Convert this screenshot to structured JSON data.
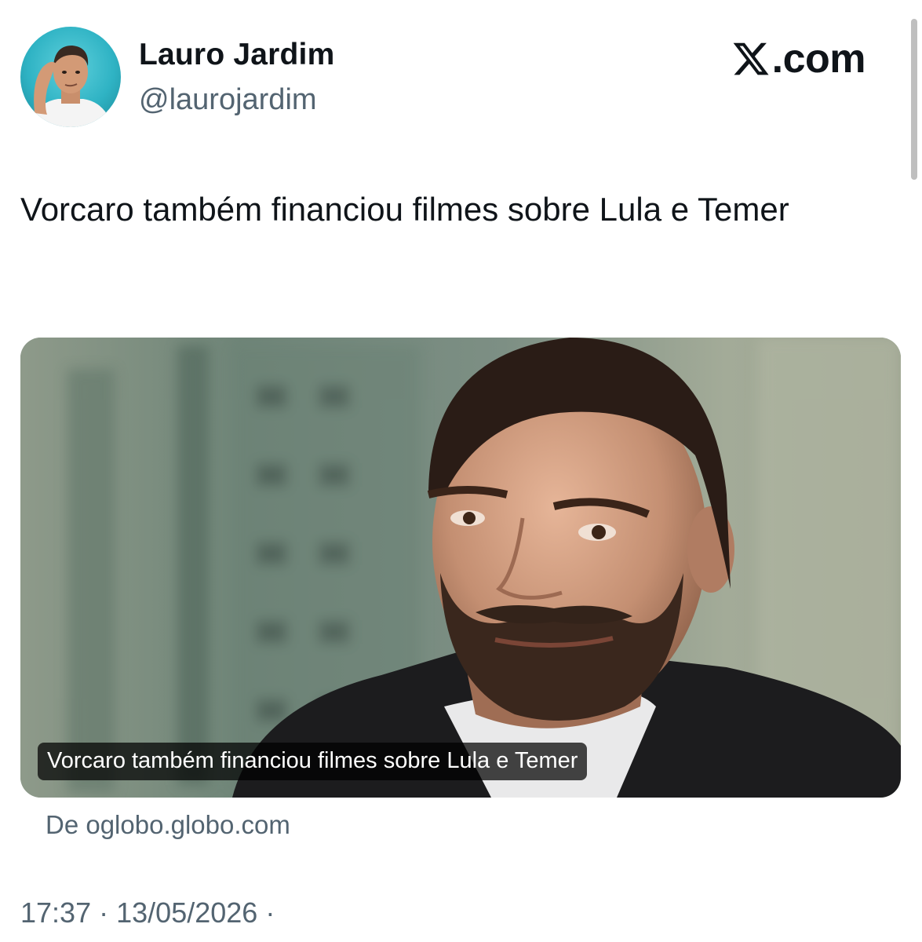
{
  "author": {
    "display_name": "Lauro Jardim",
    "handle": "@laurojardim",
    "avatar_icon": "profile-photo"
  },
  "brand": {
    "text": ".com",
    "logo_icon": "x-logo-icon"
  },
  "tweet": {
    "text": "Vorcaro também financiou filmes sobre Lula e Temer"
  },
  "card": {
    "caption": "Vorcaro também financiou filmes sobre Lula e Temer",
    "source": "De oglobo.globo.com",
    "image": "photo-of-bearded-man-in-suit"
  },
  "meta": {
    "time": "17:37",
    "date": "13/05/2026",
    "separator": "·"
  },
  "colors": {
    "text_primary": "#0f1419",
    "text_secondary": "#536471",
    "avatar_bg": "#2fb3c4"
  }
}
